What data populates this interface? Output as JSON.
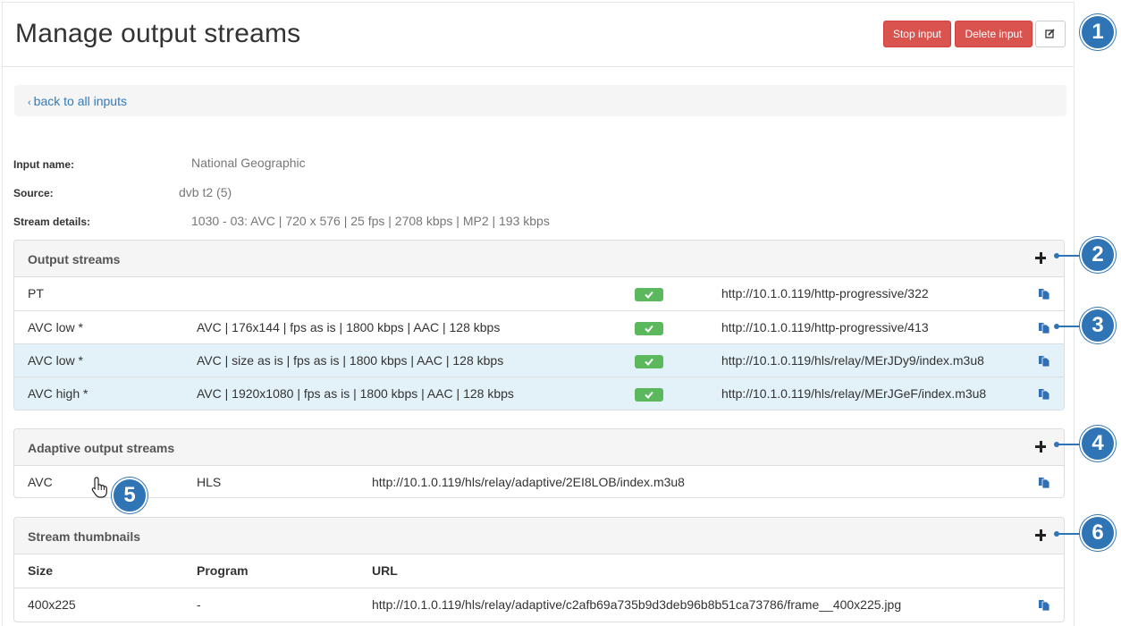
{
  "header": {
    "title": "Manage output streams",
    "stop_label": "Stop input",
    "delete_label": "Delete input",
    "edit_icon": "edit-icon"
  },
  "breadcrumb": {
    "back_label": "back to all inputs",
    "chevron": "‹"
  },
  "info": {
    "input_name_label": "Input name:",
    "input_name_value": "National Geographic",
    "source_label": "Source:",
    "source_value": "dvb t2 (5)",
    "details_label": "Stream details:",
    "details_value": "1030 - 03: AVC | 720 x 576 | 25 fps | 2708 kbps | MP2 | 193 kbps"
  },
  "output_streams": {
    "title": "Output streams",
    "rows": [
      {
        "name": "PT",
        "details": "",
        "url": "http://10.1.0.119/http-progressive/322",
        "highlight": false
      },
      {
        "name": "AVC low *",
        "details": "AVC | 176x144 | fps as is | 1800 kbps | AAC | 128 kbps",
        "url": "http://10.1.0.119/http-progressive/413",
        "highlight": false
      },
      {
        "name": "AVC low *",
        "details": "AVC | size as is | fps as is | 1800 kbps | AAC | 128 kbps",
        "url": "http://10.1.0.119/hls/relay/MErJDy9/index.m3u8",
        "highlight": true
      },
      {
        "name": "AVC high *",
        "details": "AVC | 1920x1080 | fps as is | 1800 kbps | AAC | 128 kbps",
        "url": "http://10.1.0.119/hls/relay/MErJGeF/index.m3u8",
        "highlight": true
      }
    ]
  },
  "adaptive_streams": {
    "title": "Adaptive output streams",
    "rows": [
      {
        "name": "AVC",
        "protocol": "HLS",
        "url": "http://10.1.0.119/hls/relay/adaptive/2EI8LOB/index.m3u8"
      }
    ]
  },
  "thumbnails": {
    "title": "Stream thumbnails",
    "headers": {
      "size": "Size",
      "program": "Program",
      "url": "URL"
    },
    "rows": [
      {
        "size": "400x225",
        "program": "-",
        "url": "http://10.1.0.119/hls/relay/adaptive/c2afb69a735b9d3deb96b8b51ca73786/frame__400x225.jpg"
      }
    ]
  },
  "callouts": [
    "1",
    "2",
    "3",
    "4",
    "5",
    "6"
  ],
  "colors": {
    "danger": "#d9534f",
    "success": "#5cb85c",
    "link": "#337ab7",
    "callout": "#2f74b5",
    "highlight_row": "#e3f1f8"
  }
}
